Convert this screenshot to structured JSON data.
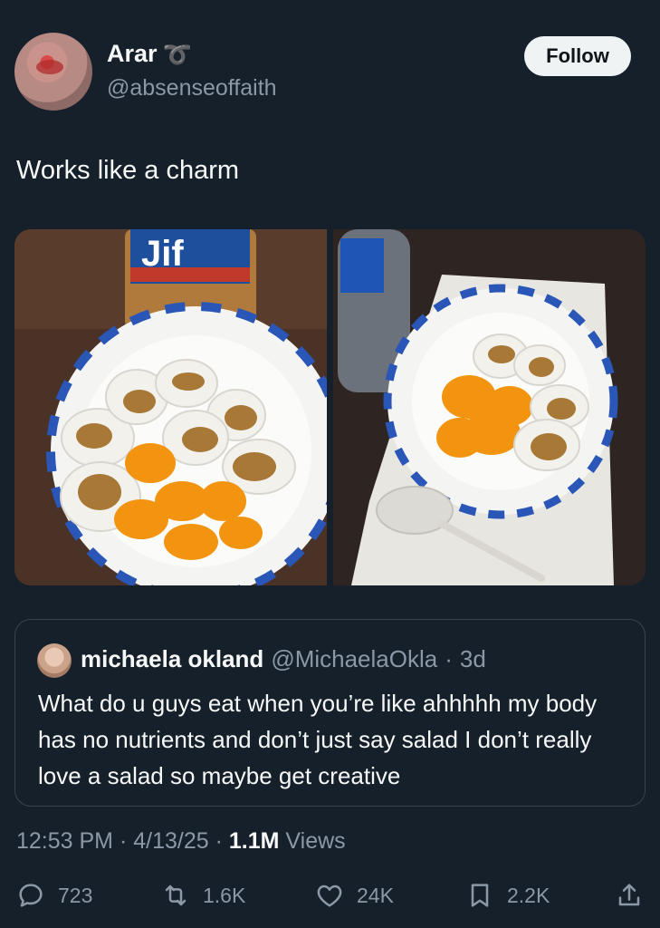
{
  "author": {
    "display_name": "Arar",
    "name_emoji": "➰",
    "handle": "@absenseoffaith"
  },
  "follow_label": "Follow",
  "tweet_text": "Works like a charm",
  "media": {
    "left_icon": "photo-peanut-butter-eggs-jar",
    "right_icon": "photo-eggs-oranges-bottle"
  },
  "quoted": {
    "display_name": "michaela okland",
    "handle": "@MichaelaOkla",
    "separator": "·",
    "time": "3d",
    "text": "What do u guys eat when you’re like ahhhhh my body has no nutrients and don’t just say salad I don’t really love a salad so maybe get creative"
  },
  "meta": {
    "time": "12:53 PM",
    "sep1": " · ",
    "date": "4/13/25",
    "sep2": " · ",
    "views_count": "1.1M",
    "views_label": " Views"
  },
  "actions": {
    "replies": "723",
    "reposts": "1.6K",
    "likes": "24K",
    "bookmarks": "2.2K"
  },
  "colors": {
    "background": "#15202b",
    "text": "#f7f9f9",
    "muted": "#8b98a5",
    "border": "#38444d"
  }
}
